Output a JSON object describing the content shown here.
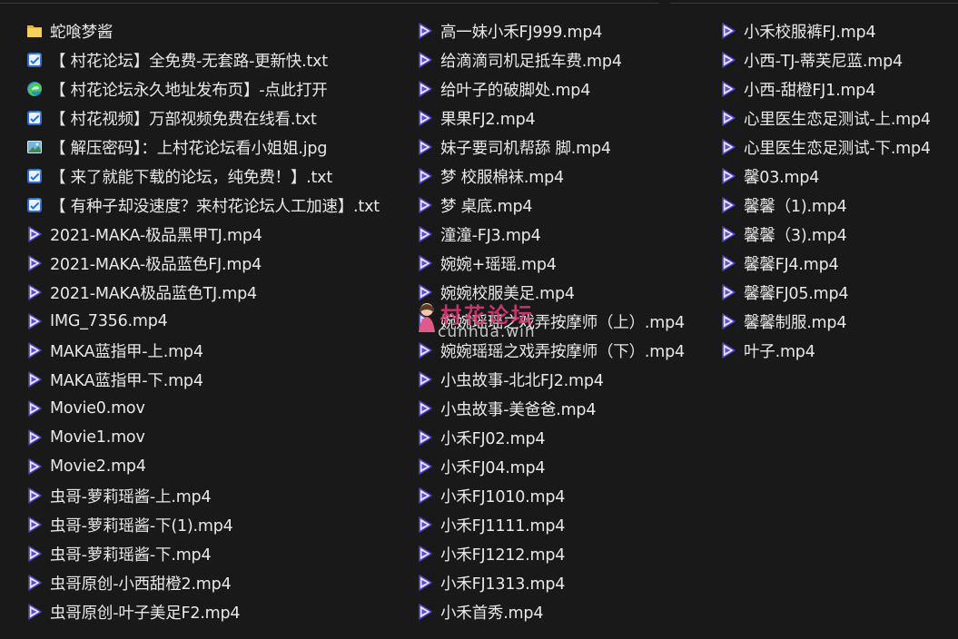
{
  "columns": [
    [
      {
        "icon": "folder",
        "name": "蛇喰梦酱"
      },
      {
        "icon": "txt",
        "name": "【 村花论坛】全免费-无套路-更新快.txt"
      },
      {
        "icon": "edge",
        "name": "【 村花论坛永久地址发布页】-点此打开"
      },
      {
        "icon": "txt",
        "name": "【 村花视频】万部视频免费在线看.txt"
      },
      {
        "icon": "jpg",
        "name": "【 解压密码】：上村花论坛看小姐姐.jpg"
      },
      {
        "icon": "txt",
        "name": "【 来了就能下载的论坛，纯免费！】.txt"
      },
      {
        "icon": "txt",
        "name": "【 有种子却没速度？来村花论坛人工加速】.txt"
      },
      {
        "icon": "video",
        "name": "2021-MAKA-极品黑甲TJ.mp4"
      },
      {
        "icon": "video",
        "name": "2021-MAKA-极品蓝色FJ.mp4"
      },
      {
        "icon": "video",
        "name": "2021-MAKA极品蓝色TJ.mp4"
      },
      {
        "icon": "video",
        "name": "IMG_7356.mp4"
      },
      {
        "icon": "video",
        "name": "MAKA蓝指甲-上.mp4"
      },
      {
        "icon": "video",
        "name": "MAKA蓝指甲-下.mp4"
      },
      {
        "icon": "video",
        "name": "Movie0.mov"
      },
      {
        "icon": "video",
        "name": "Movie1.mov"
      },
      {
        "icon": "video",
        "name": "Movie2.mp4"
      },
      {
        "icon": "video",
        "name": "虫哥-萝莉瑶酱-上.mp4"
      },
      {
        "icon": "video",
        "name": "虫哥-萝莉瑶酱-下(1).mp4"
      },
      {
        "icon": "video",
        "name": "虫哥-萝莉瑶酱-下.mp4"
      },
      {
        "icon": "video",
        "name": "虫哥原创-小西甜橙2.mp4"
      },
      {
        "icon": "video",
        "name": "虫哥原创-叶子美足F2.mp4"
      }
    ],
    [
      {
        "icon": "video",
        "name": "高一妹小禾FJ999.mp4"
      },
      {
        "icon": "video",
        "name": "给滴滴司机足抵车费.mp4"
      },
      {
        "icon": "video",
        "name": "给叶子的破脚处.mp4"
      },
      {
        "icon": "video",
        "name": "果果FJ2.mp4"
      },
      {
        "icon": "video",
        "name": "妹子要司机帮舔 脚.mp4"
      },
      {
        "icon": "video",
        "name": "梦 校服棉袜.mp4"
      },
      {
        "icon": "video",
        "name": "梦 桌底.mp4"
      },
      {
        "icon": "video",
        "name": "潼潼-FJ3.mp4"
      },
      {
        "icon": "video",
        "name": "婉婉+瑶瑶.mp4"
      },
      {
        "icon": "video",
        "name": "婉婉校服美足.mp4"
      },
      {
        "icon": "video",
        "name": "婉婉瑶瑶之戏弄按摩师（上）.mp4"
      },
      {
        "icon": "video",
        "name": "婉婉瑶瑶之戏弄按摩师（下）.mp4"
      },
      {
        "icon": "video",
        "name": "小虫故事-北北FJ2.mp4"
      },
      {
        "icon": "video",
        "name": "小虫故事-美爸爸.mp4"
      },
      {
        "icon": "video",
        "name": "小禾FJ02.mp4"
      },
      {
        "icon": "video",
        "name": "小禾FJ04.mp4"
      },
      {
        "icon": "video",
        "name": "小禾FJ1010.mp4"
      },
      {
        "icon": "video",
        "name": "小禾FJ1111.mp4"
      },
      {
        "icon": "video",
        "name": "小禾FJ1212.mp4"
      },
      {
        "icon": "video",
        "name": "小禾FJ1313.mp4"
      },
      {
        "icon": "video",
        "name": "小禾首秀.mp4"
      }
    ],
    [
      {
        "icon": "video",
        "name": "小禾校服裤FJ.mp4"
      },
      {
        "icon": "video",
        "name": "小西-TJ-蒂芙尼蓝.mp4"
      },
      {
        "icon": "video",
        "name": "小西-甜橙FJ1.mp4"
      },
      {
        "icon": "video",
        "name": "心里医生恋足测试-上.mp4"
      },
      {
        "icon": "video",
        "name": "心里医生恋足测试-下.mp4"
      },
      {
        "icon": "video",
        "name": "馨03.mp4"
      },
      {
        "icon": "video",
        "name": "馨馨（1).mp4"
      },
      {
        "icon": "video",
        "name": "馨馨（3).mp4"
      },
      {
        "icon": "video",
        "name": "馨馨FJ4.mp4"
      },
      {
        "icon": "video",
        "name": "馨馨FJ05.mp4"
      },
      {
        "icon": "video",
        "name": "馨馨制服.mp4"
      },
      {
        "icon": "video",
        "name": "叶子.mp4"
      }
    ]
  ],
  "watermark": {
    "title": "村花论坛",
    "subtitle": "cunhua.win"
  },
  "colors": {
    "background": "#191919",
    "text": "#e8e8e8",
    "folder": "#f2c54b",
    "video_accent": "#5b4bd8",
    "txt_accent": "#3a7bd5"
  }
}
